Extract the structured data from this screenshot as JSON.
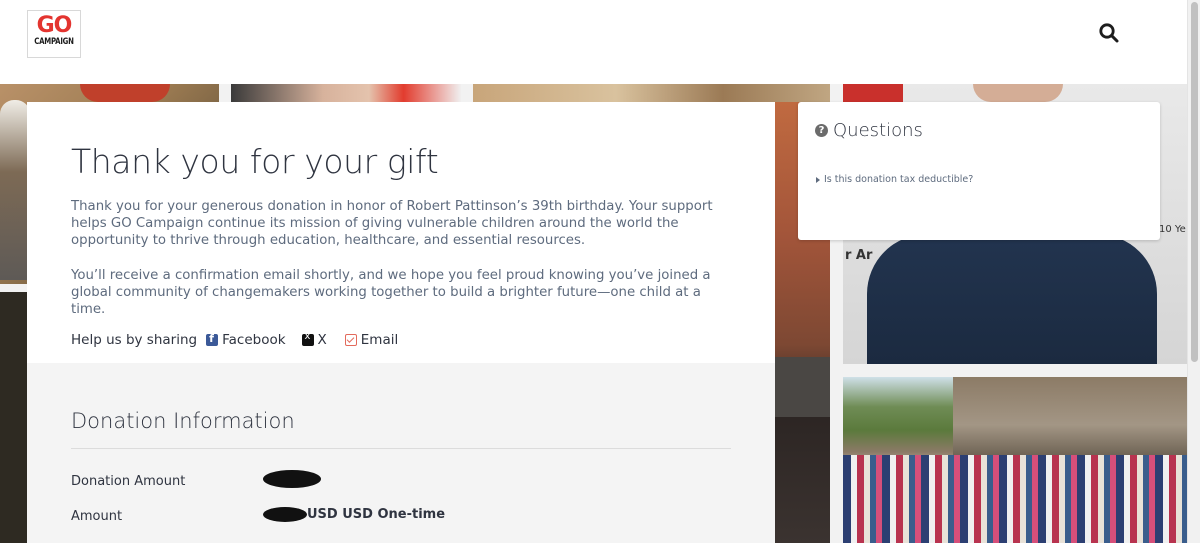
{
  "header": {
    "logo": {
      "line1": "GO",
      "line2": "CAMPAIGN",
      "line3": ""
    },
    "search_icon": "search-icon"
  },
  "thank_you": {
    "title": "Thank you for your gift",
    "paragraph1": "Thank you for your generous donation in honor of Robert Pattinson’s 39th birthday. Your support helps GO Campaign continue its mission of giving vulnerable children around the world the opportunity to thrive through education, healthcare, and essential resources.",
    "paragraph2": "You’ll receive a confirmation email shortly, and we hope you feel proud knowing you’ve joined a global community of changemakers working together to build a brighter future—one child at a time."
  },
  "share": {
    "label": "Help us by sharing",
    "links": [
      {
        "label": "Facebook",
        "icon": "facebook-icon",
        "color": "#3b5998"
      },
      {
        "label": "X",
        "icon": "x-icon",
        "color": "#111111"
      },
      {
        "label": "Email",
        "icon": "email-icon",
        "color": "#e36a5c"
      }
    ]
  },
  "donation_info": {
    "title": "Donation Information",
    "rows": [
      {
        "label": "Donation Amount",
        "value": ""
      },
      {
        "label": "Amount",
        "value": "USD USD One-time"
      }
    ]
  },
  "questions": {
    "title": "Questions",
    "icon": "question-circle-icon",
    "items": [
      {
        "label": "Is this donation tax deductible?"
      }
    ]
  },
  "background_photo_text": {
    "left_fragment": "r Ar",
    "right_fragment": "10 Ye"
  },
  "colors": {
    "brand_red": "#e3342f",
    "card_bg": "#ffffff",
    "info_bg": "#f4f4f4",
    "text": "#2f3440",
    "muted_text": "#5e6b7e"
  }
}
